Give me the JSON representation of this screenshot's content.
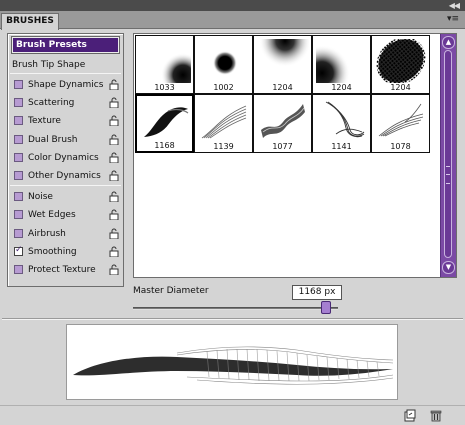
{
  "panel": {
    "tab_label": "BRUSHES",
    "collapse_glyph": "◀◀",
    "menu_glyph": "▾≡"
  },
  "options": {
    "presets_label": "Brush Presets",
    "tip_shape_label": "Brush Tip Shape",
    "dynamics": [
      {
        "label": "Shape Dynamics",
        "checked": false
      },
      {
        "label": "Scattering",
        "checked": false
      },
      {
        "label": "Texture",
        "checked": false
      },
      {
        "label": "Dual Brush",
        "checked": false
      },
      {
        "label": "Color Dynamics",
        "checked": false
      },
      {
        "label": "Other Dynamics",
        "checked": false
      }
    ],
    "extras": [
      {
        "label": "Noise",
        "checked": false
      },
      {
        "label": "Wet Edges",
        "checked": false
      },
      {
        "label": "Airbrush",
        "checked": false
      },
      {
        "label": "Smoothing",
        "checked": true
      },
      {
        "label": "Protect Texture",
        "checked": false
      }
    ]
  },
  "brushes": [
    {
      "size": "1033",
      "shape": "soft-round"
    },
    {
      "size": "1002",
      "shape": "hard-round"
    },
    {
      "size": "1204",
      "shape": "soft-round-top"
    },
    {
      "size": "1204",
      "shape": "soft-round-left"
    },
    {
      "size": "1204",
      "shape": "halftone"
    },
    {
      "size": "1168",
      "shape": "stroke-a",
      "selected": true
    },
    {
      "size": "1139",
      "shape": "stroke-b"
    },
    {
      "size": "1077",
      "shape": "stroke-c"
    },
    {
      "size": "1141",
      "shape": "stroke-d"
    },
    {
      "size": "1078",
      "shape": "stroke-e"
    }
  ],
  "master_diameter": {
    "label": "Master Diameter",
    "value": "1168 px",
    "slider_fraction": 0.94
  },
  "colors": {
    "accent": "#4b1f79",
    "scrollbar": "#7b4aa5",
    "checkbox": "#b79bd2"
  },
  "footer": {
    "new_icon": "new-brush-icon",
    "delete_icon": "trash-icon"
  }
}
